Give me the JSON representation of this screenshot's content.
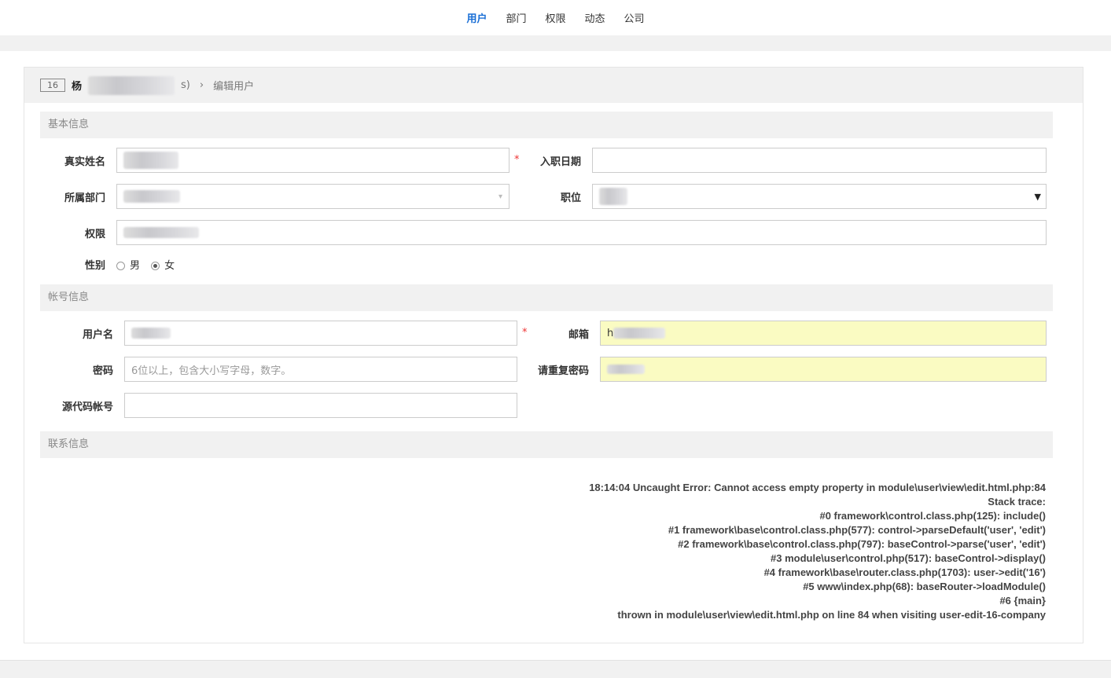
{
  "nav": {
    "items": [
      "用户",
      "部门",
      "权限",
      "动态",
      "公司"
    ],
    "active": 0
  },
  "header": {
    "id": "16",
    "name_prefix": "杨",
    "name_suffix": "s)",
    "crumb": "编辑用户"
  },
  "sections": {
    "basic": "基本信息",
    "account": "帐号信息",
    "contact": "联系信息"
  },
  "form": {
    "realname_label": "真实姓名",
    "join_label": "入职日期",
    "dept_label": "所属部门",
    "role_label": "职位",
    "priv_label": "权限",
    "gender_label": "性别",
    "gender_male": "男",
    "gender_female": "女",
    "account_label": "用户名",
    "email_label": "邮箱",
    "email_prefix": "h",
    "password_label": "密码",
    "password_placeholder": "6位以上，包含大小写字母，数字。",
    "repeat_label": "请重复密码",
    "commiter_label": "源代码帐号",
    "required": "*",
    "select_arrow": "▾"
  },
  "error": {
    "lines": [
      "18:14:04 Uncaught Error: Cannot access empty property in module\\user\\view\\edit.html.php:84",
      "Stack trace:",
      "#0 framework\\control.class.php(125): include()",
      "#1 framework\\base\\control.class.php(577): control->parseDefault('user', 'edit')",
      "#2 framework\\base\\control.class.php(797): baseControl->parse('user', 'edit')",
      "#3 module\\user\\control.php(517): baseControl->display()",
      "#4 framework\\base\\router.class.php(1703): user->edit('16')",
      "#5 www\\index.php(68): baseRouter->loadModule()",
      "#6 {main}",
      "thrown in module\\user\\view\\edit.html.php on line 84 when visiting user-edit-16-company"
    ]
  }
}
